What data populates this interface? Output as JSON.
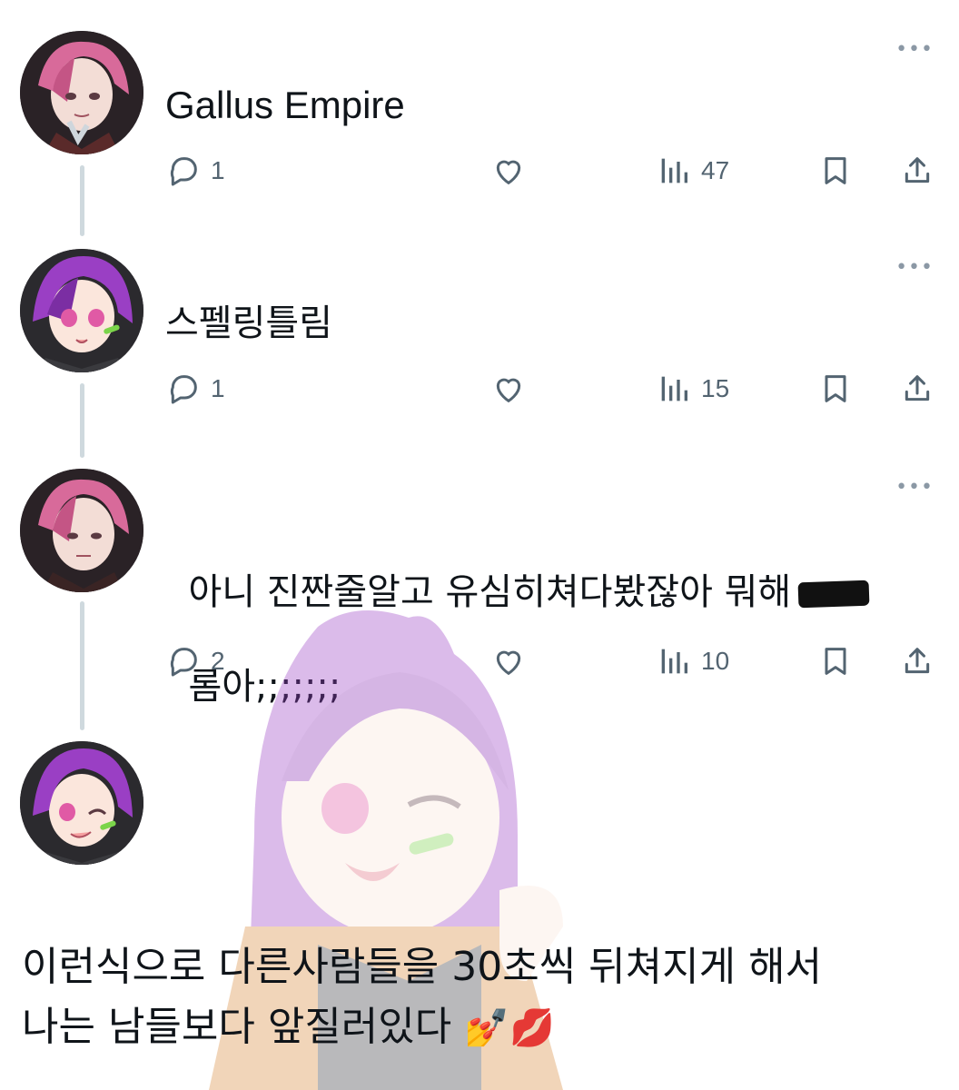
{
  "posts": [
    {
      "author": "Gallus Empire",
      "text": "Gallus Empire",
      "more": "•••",
      "replies": "1",
      "views": "47"
    },
    {
      "text": "스펠링틀림",
      "more": "•••",
      "replies": "1",
      "views": "15"
    },
    {
      "text_line1": "아니 진짠줄알고 유심히쳐다봤잖아 뭐해",
      "text_line2": "롬아;;;;;;;",
      "more": "•••",
      "replies": "2",
      "views": "10"
    }
  ],
  "final_post": {
    "line1": "이런식으로 다른사람들을 30초씩 뒤쳐지게 해서",
    "line2": "나는 남들보다 앞질러있다",
    "emoji": "💅💋"
  },
  "icons": [
    "reply-icon",
    "like-icon",
    "views-icon",
    "bookmark-icon",
    "share-icon",
    "more-icon"
  ],
  "colors": {
    "text": "#0f1419",
    "icon": "#536471",
    "thread_line": "#cfd9de",
    "avatar_pink_hair": "#d86a9a",
    "avatar_purple_hair": "#9a3fc4"
  }
}
